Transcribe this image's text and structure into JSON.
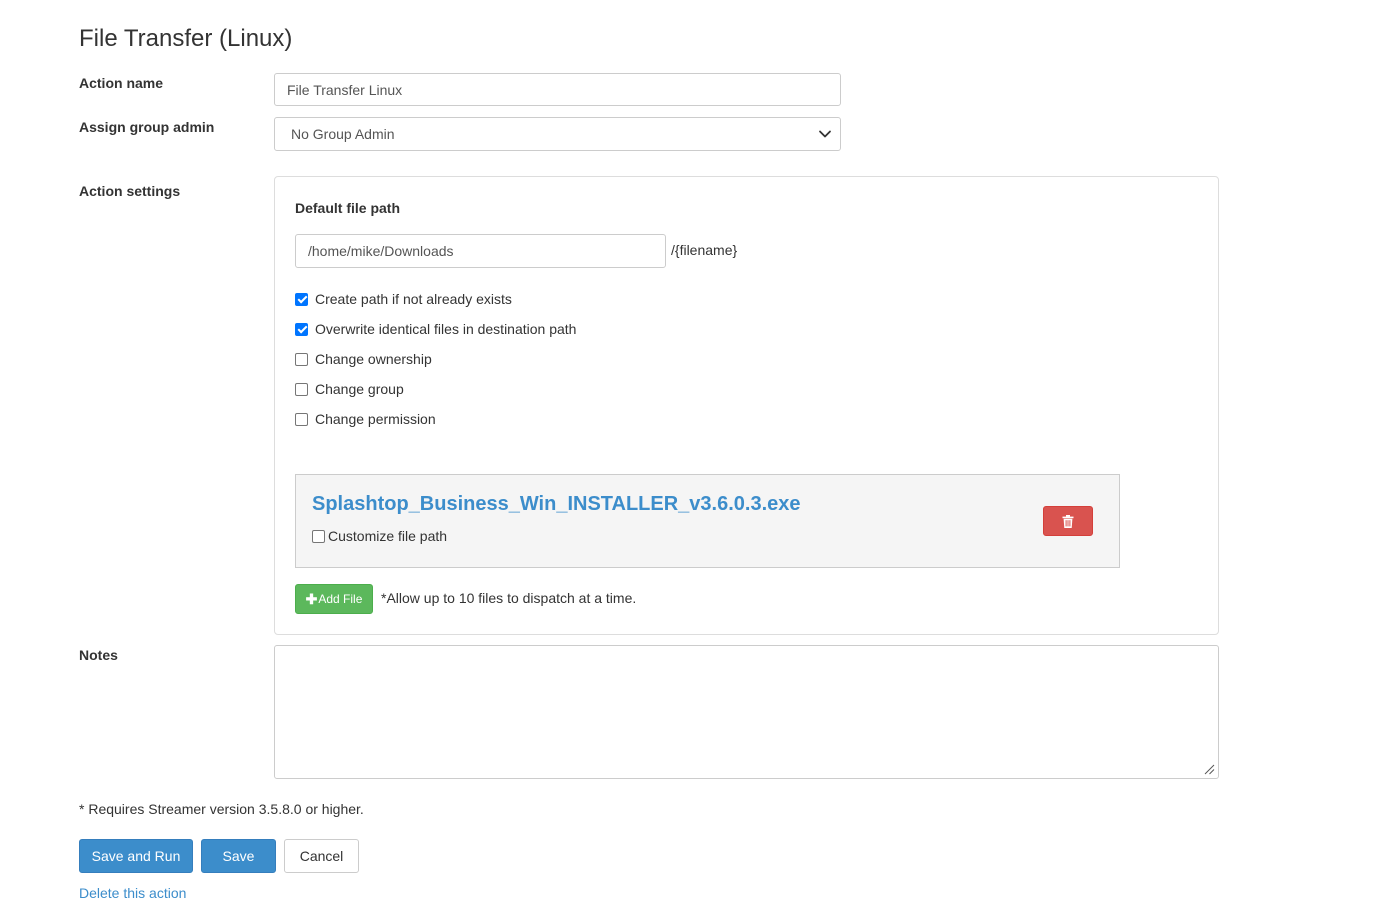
{
  "page": {
    "title": "File Transfer (Linux)"
  },
  "form": {
    "action_name": {
      "label": "Action name",
      "value": "File Transfer Linux"
    },
    "group_admin": {
      "label": "Assign group admin",
      "selected": "No Group Admin"
    },
    "action_settings": {
      "label": "Action settings",
      "default_path_label": "Default file path",
      "default_path_value": "/home/mike/Downloads",
      "path_suffix": "/{filename}",
      "options": [
        {
          "label": "Create path if not already exists",
          "checked": true
        },
        {
          "label": "Overwrite identical files in destination path",
          "checked": true
        },
        {
          "label": "Change ownership",
          "checked": false
        },
        {
          "label": "Change group",
          "checked": false
        },
        {
          "label": "Change permission",
          "checked": false
        }
      ],
      "file": {
        "name": "Splashtop_Business_Win_INSTALLER_v3.6.0.3.exe",
        "customize_label": "Customize file path",
        "customize_checked": false,
        "delete_icon": "trash-icon"
      },
      "add_file_label": "Add File",
      "add_file_icon": "plus-icon",
      "allow_note": "*Allow up to 10 files to dispatch at a time."
    },
    "notes": {
      "label": "Notes",
      "value": ""
    }
  },
  "footer": {
    "requirement_note": "* Requires Streamer version 3.5.8.0 or higher.",
    "save_and_run_label": "Save and Run",
    "save_label": "Save",
    "cancel_label": "Cancel",
    "delete_link": "Delete this action"
  },
  "colors": {
    "primary": "#3c8dcb",
    "danger": "#d9534f",
    "success": "#5cb85c",
    "checkbox_checked": "#0075ff"
  }
}
